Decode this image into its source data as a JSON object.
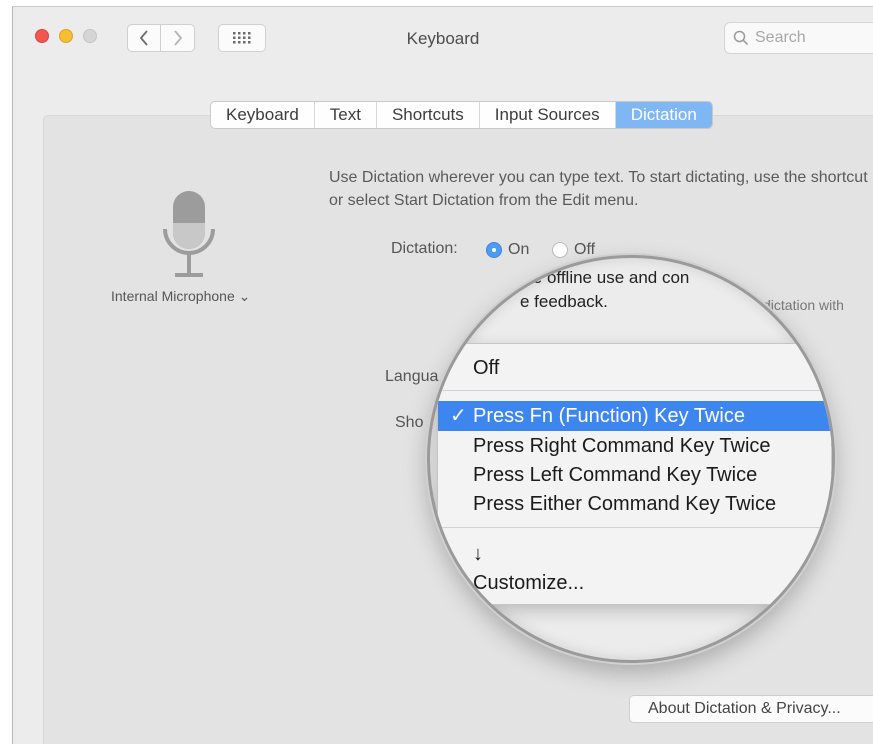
{
  "window": {
    "title": "Keyboard",
    "search_placeholder": "Search"
  },
  "tabs": [
    {
      "label": "Keyboard",
      "active": false
    },
    {
      "label": "Text",
      "active": false
    },
    {
      "label": "Shortcuts",
      "active": false
    },
    {
      "label": "Input Sources",
      "active": false
    },
    {
      "label": "Dictation",
      "active": true
    }
  ],
  "microphone": {
    "label": "Internal Microphone ⌄"
  },
  "dictation": {
    "description": "Use Dictation wherever you can type text. To start dictating, use the shortcut or select Start Dictation from the Edit menu.",
    "label": "Dictation:",
    "on_label": "On",
    "off_label": "Off",
    "enhanced_line1": "Use offline use and con",
    "enhanced_line2": "e feedback.",
    "side_text": "dictation with",
    "language_label": "Langua",
    "shortcut_label": "Sho"
  },
  "shortcut_menu": {
    "items": [
      {
        "label": "Off",
        "selected": false
      },
      {
        "label": "Press Fn (Function) Key Twice",
        "selected": true
      },
      {
        "label": "Press Right Command Key Twice",
        "selected": false
      },
      {
        "label": "Press Left Command Key Twice",
        "selected": false
      },
      {
        "label": "Press Either Command Key Twice",
        "selected": false
      },
      {
        "label": "↓",
        "selected": false
      },
      {
        "label": "Customize...",
        "selected": false
      }
    ],
    "check_glyph": "✓"
  },
  "about_button": "About Dictation & Privacy...",
  "colors": {
    "accent": "#3d86f0",
    "active_tab": "#7fb7f5",
    "close": "#f2564e",
    "minimize": "#f6be31"
  }
}
